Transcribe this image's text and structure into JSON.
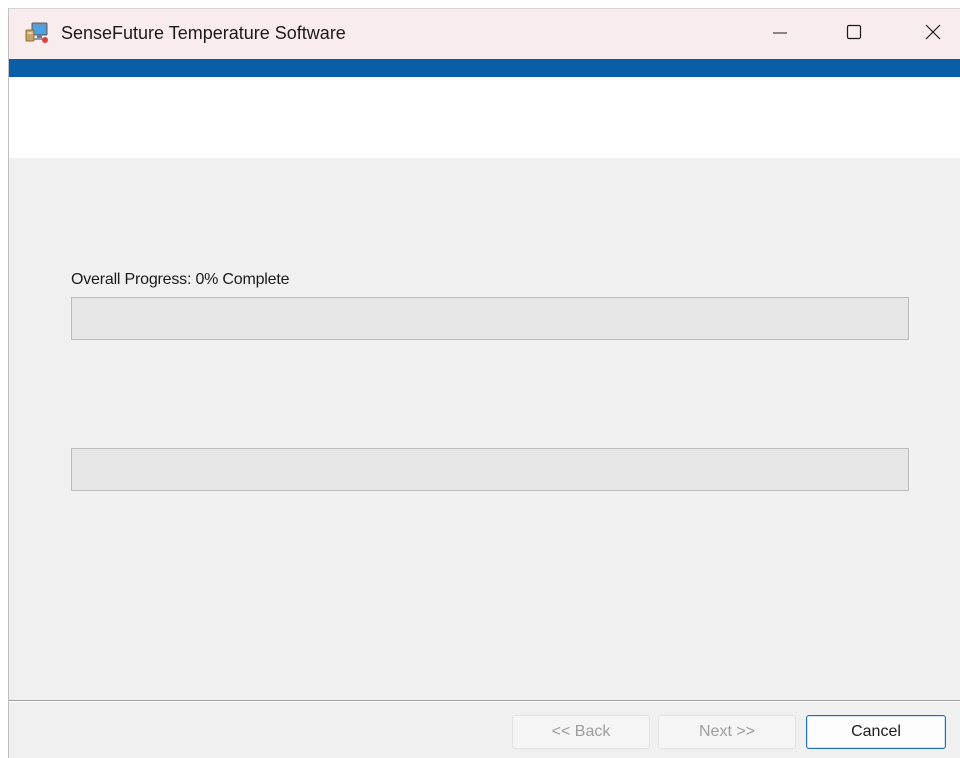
{
  "window": {
    "title": "SenseFuture Temperature Software",
    "icon": "installer-computer-icon"
  },
  "title_controls": {
    "minimize_icon": "minimize-icon",
    "maximize_icon": "maximize-icon",
    "close_icon": "close-icon"
  },
  "progress": {
    "overall_label": "Overall Progress: 0% Complete",
    "overall_value": 0,
    "secondary_value": 0
  },
  "footer": {
    "back_label": "<< Back",
    "next_label": "Next >>",
    "cancel_label": "Cancel"
  },
  "colors": {
    "accent": "#0a5da7",
    "titlebar": "#f9ecec",
    "progress_fill": "#06b025",
    "default_button_border": "#1f6fb7"
  }
}
